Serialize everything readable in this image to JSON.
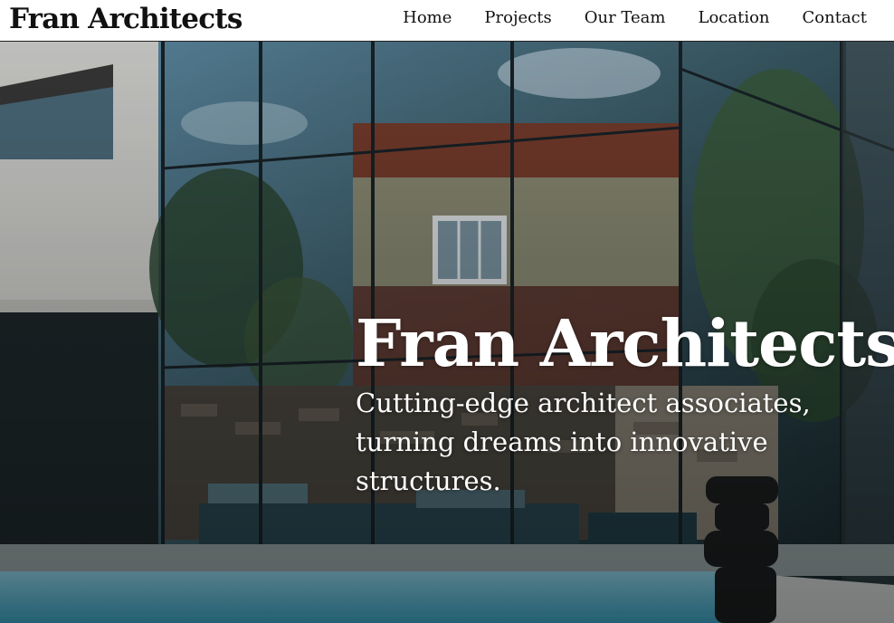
{
  "header": {
    "brand": "Fran Architects",
    "nav": [
      {
        "label": "Home"
      },
      {
        "label": "Projects"
      },
      {
        "label": "Our Team"
      },
      {
        "label": "Location"
      },
      {
        "label": "Contact"
      }
    ]
  },
  "hero": {
    "title": "Fran Architects",
    "subtitle": "Cutting-edge architect associates, turning dreams into innovative structures."
  }
}
